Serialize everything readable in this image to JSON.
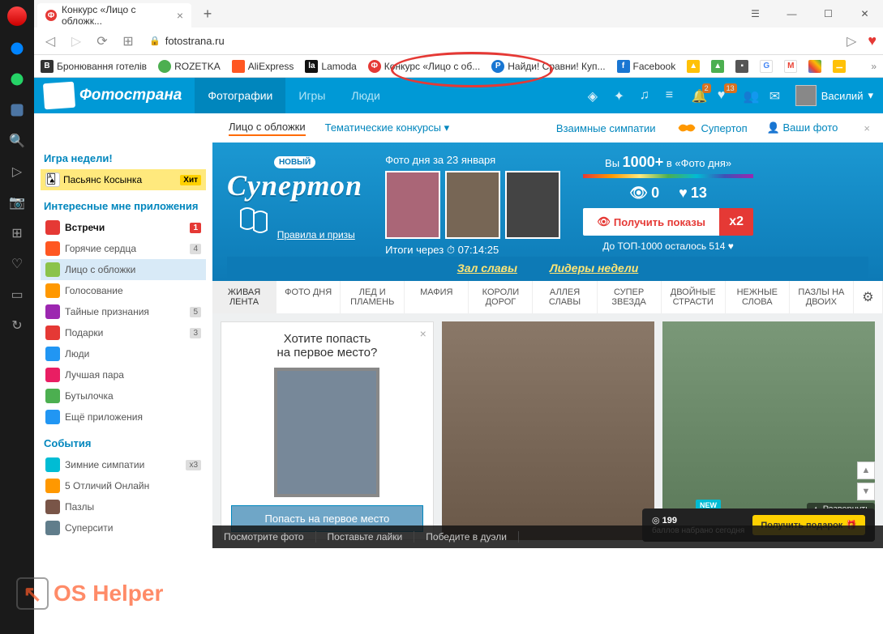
{
  "browser": {
    "tab_title": "Конкурс «Лицо с обложк...",
    "url": "fotostrana.ru",
    "bookmarks": [
      {
        "label": "Бронювання готелів",
        "color": "#333"
      },
      {
        "label": "ROZETKA",
        "color": "#4caf50"
      },
      {
        "label": "AliExpress",
        "color": "#ff5722"
      },
      {
        "label": "Lamoda",
        "color": "#111"
      },
      {
        "label": "Конкурс «Лицо с об...",
        "color": "#e53935"
      },
      {
        "label": "Найди! Сравни! Куп...",
        "color": "#1976d2"
      },
      {
        "label": "Facebook",
        "color": "#1976d2"
      }
    ]
  },
  "header": {
    "site_name": "Фотострана",
    "nav": [
      "Фотографии",
      "Игры",
      "Люди"
    ],
    "notif_count1": "2",
    "notif_count2": "13",
    "user_name": "Василий"
  },
  "subnav": {
    "items": [
      "Лицо с обложки",
      "Тематические конкурсы"
    ],
    "right": [
      "Взаимные симпатии",
      "Супертоп",
      "Ваши фото"
    ]
  },
  "sidebar": {
    "game_week_title": "Игра недели!",
    "game_week_item": "Пасьянс Косынка",
    "hit": "Хит",
    "apps_title": "Интересные мне приложения",
    "apps": [
      {
        "label": "Встречи",
        "count": "1",
        "bold": true,
        "red": true,
        "color": "#e53935"
      },
      {
        "label": "Горячие сердца",
        "count": "4",
        "color": "#ff5722"
      },
      {
        "label": "Лицо с обложки",
        "selected": true,
        "color": "#8bc34a"
      },
      {
        "label": "Голосование",
        "color": "#ff9800"
      },
      {
        "label": "Тайные признания",
        "count": "5",
        "color": "#9c27b0"
      },
      {
        "label": "Подарки",
        "count": "3",
        "color": "#e53935"
      },
      {
        "label": "Люди",
        "color": "#2196f3"
      },
      {
        "label": "Лучшая пара",
        "color": "#e91e63"
      },
      {
        "label": "Бутылочка",
        "color": "#4caf50"
      },
      {
        "label": "Ещё приложения",
        "color": "#2196f3"
      }
    ],
    "events_title": "События",
    "events": [
      {
        "label": "Зимние симпатии",
        "count": "x3",
        "color": "#00bcd4"
      },
      {
        "label": "5 Отличий Онлайн",
        "color": "#ff9800"
      },
      {
        "label": "Пазлы",
        "color": "#795548"
      },
      {
        "label": "Суперсити",
        "color": "#607d8b"
      }
    ]
  },
  "banner": {
    "novy": "НОВЫЙ",
    "title": "Супертоп",
    "rules": "Правила и призы",
    "photo_day_label": "Фото дня за 23 января",
    "countdown_label": "Итоги через",
    "countdown_time": "07:14:25",
    "stat_line_prefix": "Вы",
    "stat_line_count": "1000+",
    "stat_line_suffix": "в «Фото дня»",
    "views": "0",
    "likes": "13",
    "get_views": "Получить показы",
    "x2": "x2",
    "top1000": "До ТОП-1000 осталось 514",
    "ribbon": [
      "Зал славы",
      "Лидеры недели"
    ]
  },
  "tabs": [
    "ЖИВАЯ ЛЕНТА",
    "ФОТО ДНЯ",
    "ЛЕД И ПЛАМЕНЬ",
    "МАФИЯ",
    "КОРОЛИ ДОРОГ",
    "АЛЛЕЯ СЛАВЫ",
    "СУПЕР ЗВЕЗДА",
    "ДВОЙНЫЕ СТРАСТИ",
    "НЕЖНЫЕ СЛОВА",
    "ПАЗЛЫ НА ДВОИХ"
  ],
  "promo": {
    "title_l1": "Хотите попасть",
    "title_l2": "на первое место?",
    "btn": "Попасть на первое место"
  },
  "bottom": [
    "Посмотрите фото",
    "Поставьте лайки",
    "Победите в дуэли"
  ],
  "gift": {
    "new": "NEW",
    "points": "199",
    "points_label": "баллов набрано сегодня",
    "expand": "Развернуть",
    "btn": "Получить подарок"
  },
  "watermark": "OS Helper"
}
